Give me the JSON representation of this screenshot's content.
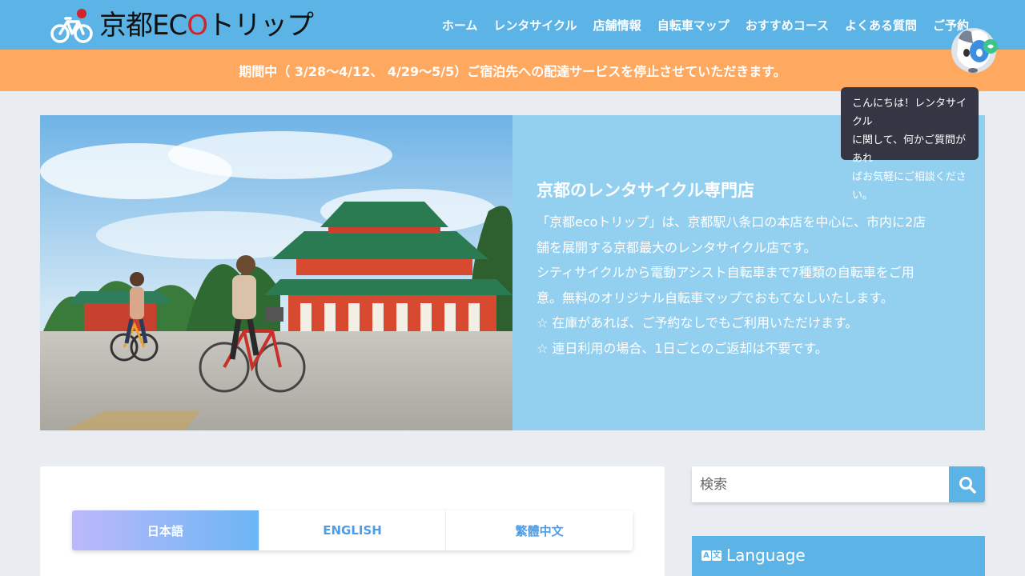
{
  "header": {
    "logo_text_pre": "京都EC",
    "logo_text_o": "O",
    "logo_text_post": "トリップ",
    "nav": [
      "ホーム",
      "レンタサイクル",
      "店舗情報",
      "自転車マップ",
      "おすすめコース",
      "よくある質問",
      "ご予約"
    ],
    "bg_color": "#5cb3e6"
  },
  "notice": {
    "text": "期間中（ 3/28〜4/12、 4/29〜5/5）ご宿泊先への配達サービスを停止させていただきます。",
    "bg_color": "#ffa960"
  },
  "hero": {
    "title": "京都のレンタサイクル専門店",
    "lines": [
      "「京都ecoトリップ」は、京都駅八条口の本店を中心に、市内に2店",
      "舗を展開する京都最大のレンタサイクル店です。",
      "シティサイクルから電動アシスト自転車まで7種類の自転車をご用",
      "意。無料のオリジナル自転車マップでおもてなしいたします。",
      "☆ 在庫があれば、ご予約なしでもご利用いただけます。",
      "☆ 連日利用の場合、1日ごとのご返却は不要です。"
    ]
  },
  "language_tabs": [
    {
      "label": "日本語",
      "active": true
    },
    {
      "label": "ENGLISH",
      "active": false
    },
    {
      "label": "繁體中文",
      "active": false
    }
  ],
  "sidebar": {
    "search_placeholder": "検索",
    "language_widget_title": "Language"
  },
  "chatbot": {
    "greeting_lines": [
      "こんにちは！レンタサイクル",
      "に関して、何かご質問があれ",
      "ばお気軽にご相談ください。"
    ]
  }
}
